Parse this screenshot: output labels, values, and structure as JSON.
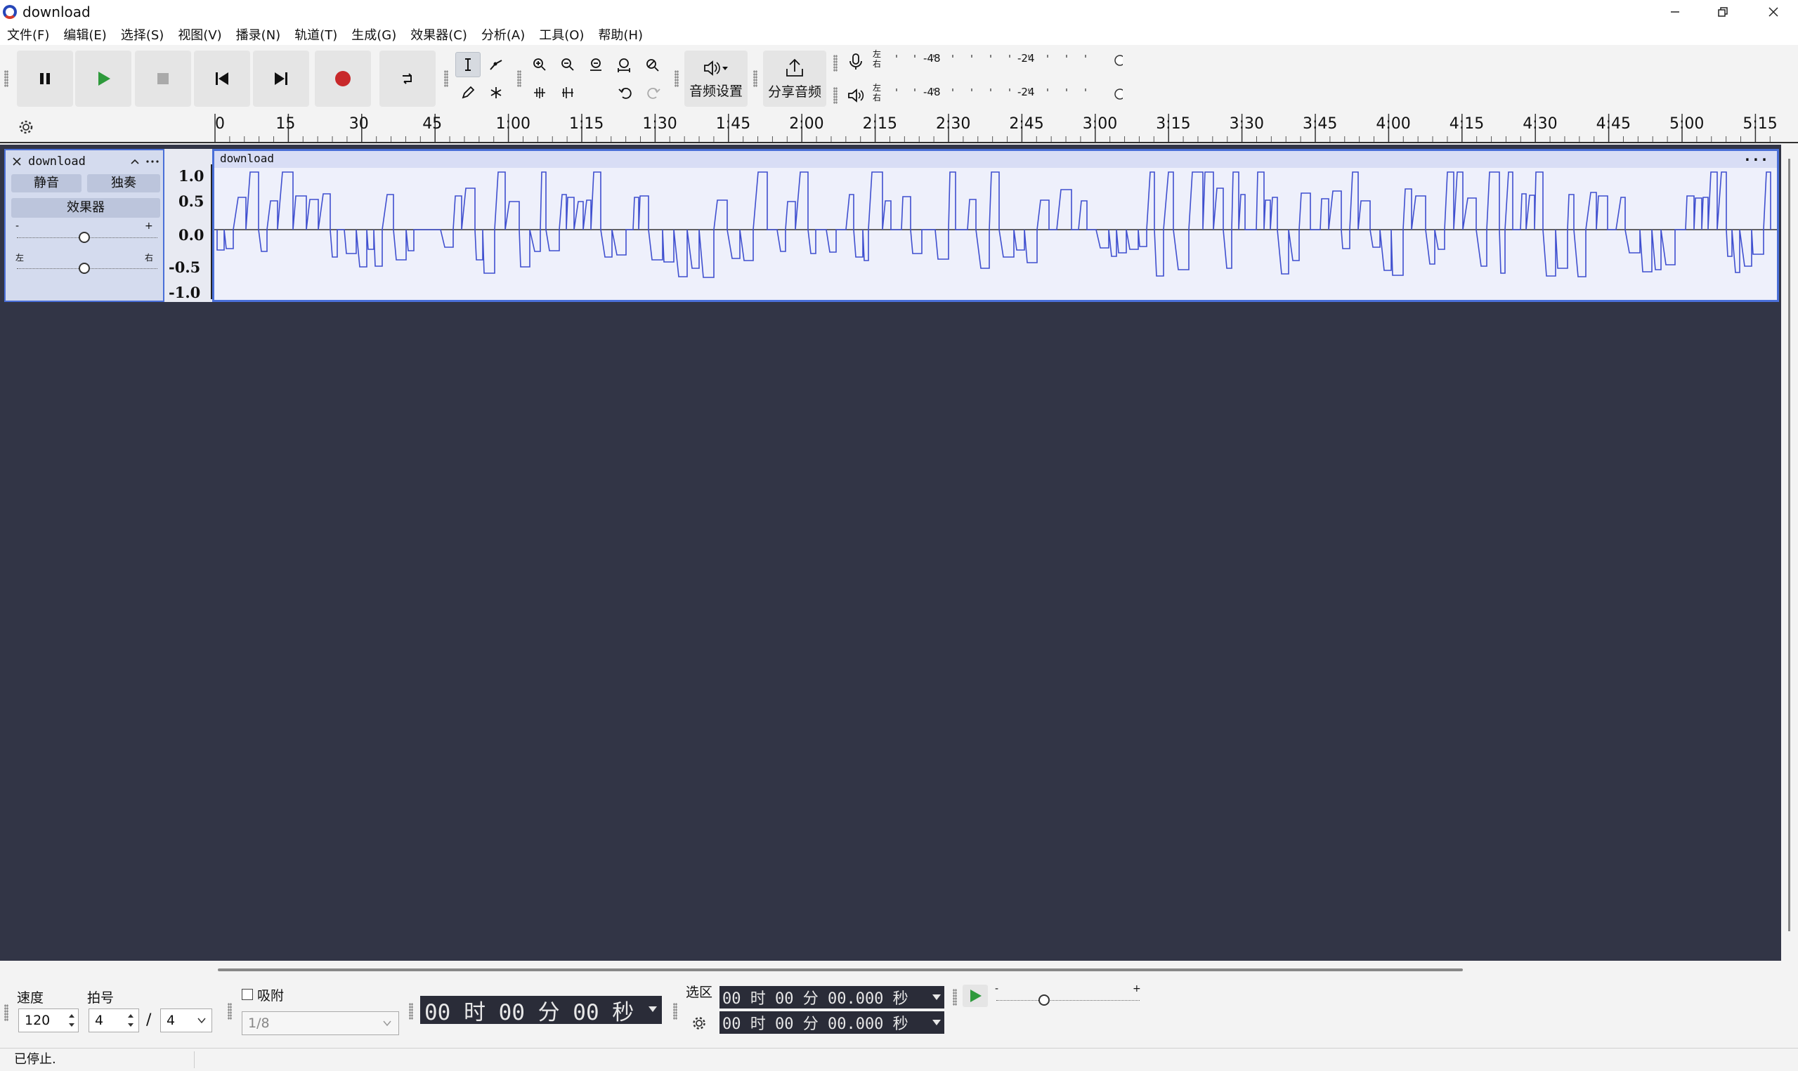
{
  "window": {
    "title": "download"
  },
  "menu": [
    "文件(F)",
    "编辑(E)",
    "选择(S)",
    "视图(V)",
    "播录(N)",
    "轨道(T)",
    "生成(G)",
    "效果器(C)",
    "分析(A)",
    "工具(O)",
    "帮助(H)"
  ],
  "toolbar": {
    "audio_settings_label": "音频设置",
    "share_audio_label": "分享音频"
  },
  "meters": {
    "record": {
      "lr_top": "左",
      "lr_bottom": "右",
      "tick_a": "-48",
      "tick_b": "-24"
    },
    "play": {
      "lr_top": "左",
      "lr_bottom": "右",
      "tick_a": "-48",
      "tick_b": "-24"
    }
  },
  "ruler": {
    "ticks": [
      "0",
      "15",
      "30",
      "45",
      "1:00",
      "1:15",
      "1:30",
      "1:45",
      "2:00",
      "2:15",
      "2:30",
      "2:45",
      "3:00",
      "3:15",
      "3:30",
      "3:45",
      "4:00",
      "4:15",
      "4:30",
      "4:45",
      "5:00",
      "5:15"
    ]
  },
  "track": {
    "name": "download",
    "mute_label": "静音",
    "solo_label": "独奏",
    "effects_label": "效果器",
    "gain_minus": "-",
    "gain_plus": "+",
    "pan_left": "左",
    "pan_right": "右",
    "scale": [
      "1.0",
      "0.5",
      "0.0",
      "-0.5",
      "-1.0"
    ],
    "clip_name": "download",
    "clip_menu": "..."
  },
  "bottom": {
    "tempo_label": "速度",
    "tempo_value": "120",
    "timesig_label": "拍号",
    "timesig_num": "4",
    "timesig_sep": "/",
    "timesig_den": "4",
    "snap_label": "吸附",
    "snap_value": "1/8",
    "time_display": "00 时 00 分 00 秒",
    "selection_label": "选区",
    "sel_start": "00 时 00 分 00.000 秒",
    "sel_end": "00 时 00 分 00.000 秒",
    "speed_minus": "-",
    "speed_plus": "+"
  },
  "status": {
    "text": "已停止."
  },
  "colors": {
    "accent": "#4a6fd8",
    "workspace": "#323546",
    "waveform": "#3f4fcf",
    "record": "#c8282a",
    "play": "#2e9a3c"
  }
}
